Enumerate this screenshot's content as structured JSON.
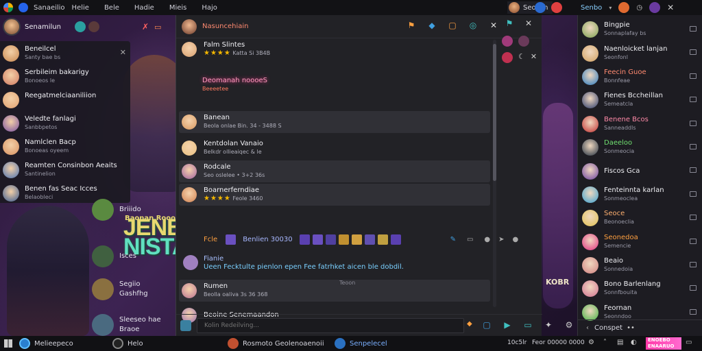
{
  "topbar": {
    "menu": [
      "Helie",
      "Bele",
      "Hadie",
      "Mieis",
      "Hajo"
    ],
    "app_title": "Sanaeilio",
    "user_name": "Seonsh"
  },
  "left": {
    "user_name": "Senamilun",
    "notifications": [
      {
        "name": "Beneilcel",
        "sub": "Santy bae bs",
        "color": "#c88850"
      },
      {
        "name": "Serbileim bakarigy",
        "sub": "Bonoeos le",
        "color": "#d07860"
      },
      {
        "name": "Reegatmelciaaniliion",
        "sub": "",
        "color": "#e0a070"
      },
      {
        "name": "Veledte fanlagi",
        "sub": "Sanbbpetos",
        "color": "#7a50a0"
      },
      {
        "name": "Namlclen Bacp",
        "sub": "Bonoeas oyeem",
        "color": "#d89060"
      },
      {
        "name": "Reamten Consinbon Aeaits",
        "sub": "Santinelion",
        "color": "#4a70b0"
      },
      {
        "name": "Benen fas Seac Icces",
        "sub": "Belaobleci",
        "color": "#3a5a90"
      }
    ],
    "minis": [
      {
        "name": "Briiido",
        "sub": "",
        "color": "#5a8a40"
      },
      {
        "name": "",
        "sub": "Isces",
        "color": "#406040"
      },
      {
        "name": "Segiio",
        "sub": "Gashfhg",
        "color": "#8a7040"
      },
      {
        "name": "Sleeseo hae",
        "sub": "Braoe",
        "color": "#4a6a80"
      }
    ]
  },
  "game": {
    "title_line1": "JENB.E",
    "title_line2": "NISTAN",
    "side_title": "Baonan Rooo",
    "corner": "KOBR"
  },
  "chat": {
    "title": "Nasuncehiain",
    "messages": [
      {
        "name": "Falm Slintes",
        "sub": "Katta Si 3B4B",
        "stars": "★★★★",
        "color": "#d8a070"
      },
      {
        "name": "Deomanah noooeS",
        "sub": "Beeeetee",
        "stars": "",
        "color": "#e05a8a"
      },
      {
        "name": "Banean",
        "sub": "Beola onlae Bin. 34 - 3488 S",
        "stars": "",
        "color": "#d89860"
      },
      {
        "name": "Kentdolan Vanaio",
        "sub": "Belkdr ollieaiqec & le",
        "stars": "",
        "color": "#e8c080"
      },
      {
        "name": "Rodcale",
        "sub": "Seo oslelee • 3+2 36s",
        "stars": "",
        "color": "#a060a0"
      },
      {
        "name": "Boarnerferndiae",
        "sub": "Feole 3460",
        "stars": "★★★★",
        "color": "#d08050"
      },
      {
        "name": "Rumen",
        "sub": "Beolla oaliva 3s 36 368",
        "stars": "",
        "color": "#b87090"
      },
      {
        "name": "Beoine Senemaandon",
        "sub": "",
        "stars": "",
        "color": "#9a70b0"
      }
    ],
    "items_label": "Fcle",
    "items_name": "Benlien 30030",
    "hint_name": "Fianie",
    "hint": "Ueen Fecktulte pienlon epen Fee fatrhket aicen ble dobdil.",
    "timestamp": "Teoon",
    "placeholder": "Kolin Redeilving..."
  },
  "right": {
    "header": "Senbo",
    "friends": [
      {
        "name": "Bingpie",
        "sub": "Sonnaplafay bs",
        "color": "#7aa050",
        "nc": "#f0f0f4"
      },
      {
        "name": "Naenloicket lanjan",
        "sub": "Seonfonl",
        "color": "#d0a060",
        "nc": "#f0f0f4"
      },
      {
        "name": "Feecin Guoe",
        "sub": "Bonnfeae",
        "color": "#2a7ac0",
        "nc": "#ff8a70"
      },
      {
        "name": "Fienes Bccheillan",
        "sub": "Semeatcla",
        "color": "#2a3a6a",
        "nc": "#f0f0f4"
      },
      {
        "name": "Benene Bcos",
        "sub": "Sanneaddls",
        "color": "#c03030",
        "nc": "#ff8aa8"
      },
      {
        "name": "Daeeloo",
        "sub": "Sonmeocia",
        "color": "#223040",
        "nc": "#70e070"
      },
      {
        "name": "Fiscos Gca",
        "sub": "",
        "color": "#6a40a0",
        "nc": "#f0f0f4"
      },
      {
        "name": "Fenteinnta karlan",
        "sub": "Sonmeoclea",
        "color": "#3aa0d0",
        "nc": "#f0f0f4"
      },
      {
        "name": "Seoce",
        "sub": "Beonoeclia",
        "color": "#e0c050",
        "nc": "#ffb070"
      },
      {
        "name": "Seonedoa",
        "sub": "Semencie",
        "color": "#e03080",
        "nc": "#ffa040"
      },
      {
        "name": "Beaio",
        "sub": "Sonnedoia",
        "color": "#d08080",
        "nc": "#f0f0f4"
      },
      {
        "name": "Bono Barlenlang",
        "sub": "Sonnfbouita",
        "color": "#d07090",
        "nc": "#f0f0f4"
      },
      {
        "name": "Feornan",
        "sub": "Seonndoo",
        "color": "#40b040",
        "nc": "#f0f0f4"
      }
    ],
    "footer": "Conspet"
  },
  "taskbar": {
    "search": "Melieepeco",
    "app2": "Helo",
    "app3": "Rosmoto Geolenoaenoii",
    "app4": "Senpelecel",
    "clock1": "10c5lr",
    "clock2": "Feor 00000 0000",
    "promo": "ENOEBO ENAARUO"
  }
}
